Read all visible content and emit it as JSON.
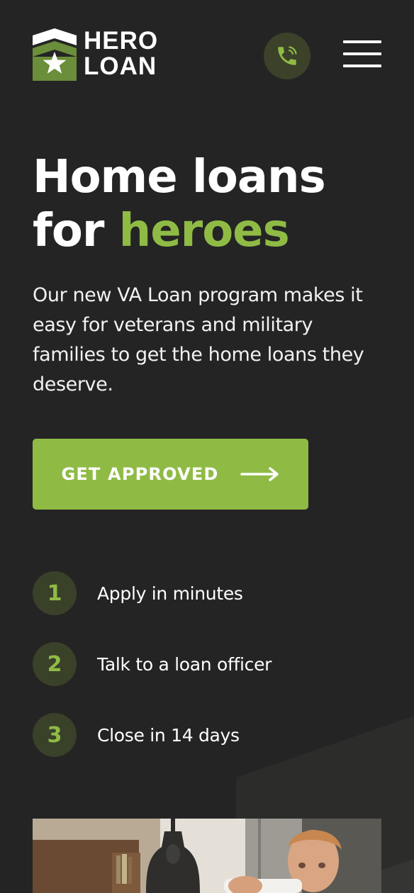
{
  "brand": {
    "logo_line1": "HERO",
    "logo_line2": "LOAN",
    "colors": {
      "background": "#242425",
      "accent": "#8fbb45",
      "circle": "#3a4129",
      "text": "#ffffff"
    }
  },
  "header": {
    "phone_icon": "phone-icon",
    "menu_icon": "hamburger-menu-icon"
  },
  "hero": {
    "title_line1": "Home loans",
    "title_line2_prefix": "for ",
    "title_line2_accent": "heroes",
    "subtitle": "Our new VA Loan program makes it easy for veterans and military families to get the home loans they deserve.",
    "cta_label": "GET APPROVED",
    "cta_icon": "arrow-right-icon"
  },
  "steps": [
    {
      "number": "1",
      "label": "Apply in minutes"
    },
    {
      "number": "2",
      "label": "Talk to a loan officer"
    },
    {
      "number": "3",
      "label": "Close in 14 days"
    }
  ]
}
